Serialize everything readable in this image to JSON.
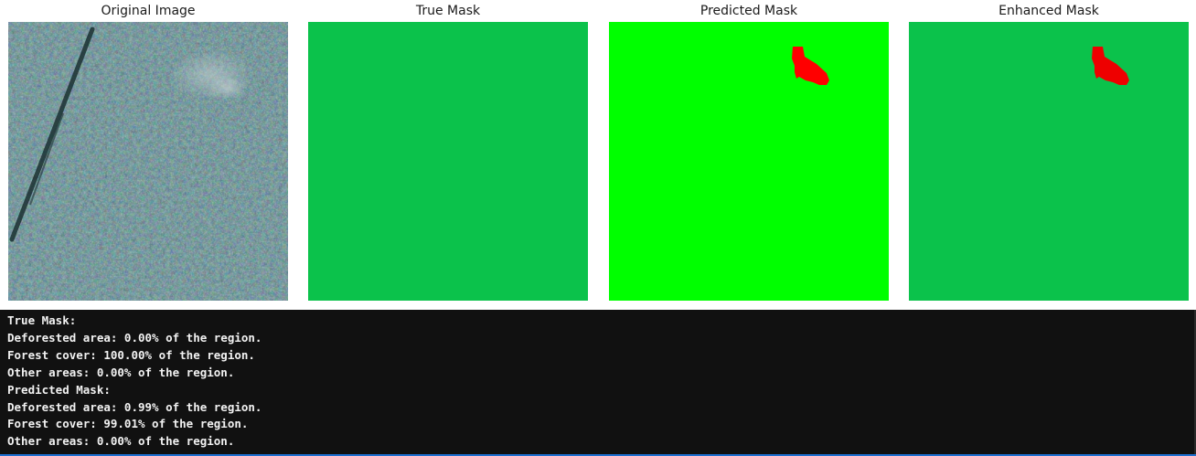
{
  "figure": {
    "panels": [
      {
        "title": "Original Image"
      },
      {
        "title": "True Mask",
        "fill_color": "#0bc24b"
      },
      {
        "title": "Predicted Mask",
        "fill_color": "#00ff00",
        "accent_color": "#ff0000"
      },
      {
        "title": "Enhanced Mask",
        "fill_color": "#0bc24b",
        "accent_color": "#ff0000"
      }
    ]
  },
  "console": {
    "lines": [
      "True Mask:",
      "Deforested area: 0.00% of the region.",
      "Forest cover: 100.00% of the region.",
      "Other areas: 0.00% of the region.",
      "Predicted Mask:",
      "Deforested area: 0.99% of the region.",
      "Forest cover: 99.01% of the region.",
      "Other areas: 0.00% of the region."
    ]
  }
}
